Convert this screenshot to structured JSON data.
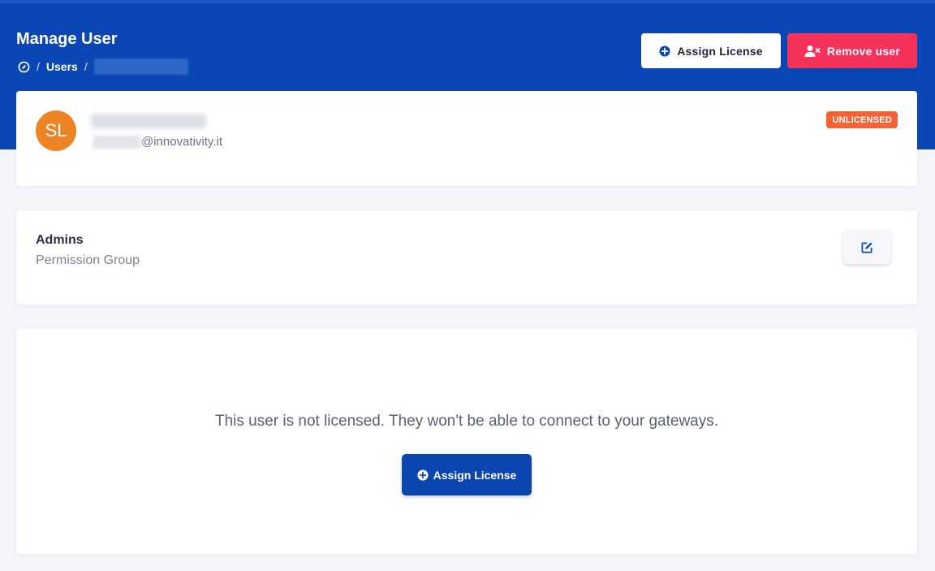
{
  "header": {
    "title": "Manage User",
    "breadcrumb": {
      "users_label": "Users",
      "separator": "/"
    },
    "actions": {
      "assign_license_label": "Assign License",
      "remove_user_label": "Remove user"
    }
  },
  "user": {
    "initials": "SL",
    "email_domain": "@innovativity.it",
    "license_status": "UNLICENSED"
  },
  "permission_group": {
    "name": "Admins",
    "caption": "Permission Group"
  },
  "license_panel": {
    "message": "This user is not licensed. They won't be able to connect to your gateways.",
    "assign_license_label": "Assign License"
  },
  "colors": {
    "brand_blue": "#0b47b4",
    "danger": "#f5325c",
    "badge_orange": "#f66234",
    "avatar_orange": "#ec8424"
  },
  "icons": {
    "breadcrumb_home": "compass-icon",
    "assign": "plus-circle-icon",
    "remove": "user-remove-icon",
    "edit": "edit-icon"
  }
}
